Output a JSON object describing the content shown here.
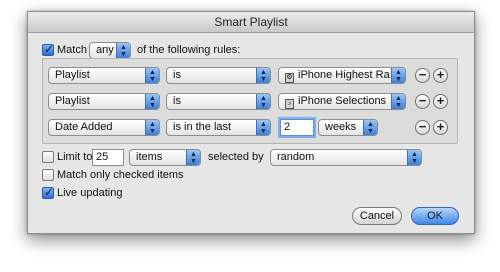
{
  "window": {
    "title": "Smart Playlist"
  },
  "header": {
    "match_label": "Match",
    "match_checked": true,
    "match_value": "any",
    "rules_suffix": "of the following rules:"
  },
  "rules": [
    {
      "field": "Playlist",
      "operator": "is",
      "value": "iPhone Highest Ra…",
      "value_icon": "smart-playlist-icon"
    },
    {
      "field": "Playlist",
      "operator": "is",
      "value": "iPhone Selections",
      "value_icon": "music-playlist-icon"
    },
    {
      "field": "Date Added",
      "operator": "is in the last",
      "number": "2",
      "unit": "weeks"
    }
  ],
  "limit": {
    "label": "Limit to",
    "checked": false,
    "amount": "25",
    "unit": "items",
    "selected_by_label": "selected by",
    "selected_by": "random"
  },
  "options": {
    "match_checked_label": "Match only checked items",
    "match_checked": false,
    "live_updating_label": "Live updating",
    "live_updating": true
  },
  "buttons": {
    "cancel": "Cancel",
    "ok": "OK",
    "remove": "−",
    "add": "+"
  }
}
